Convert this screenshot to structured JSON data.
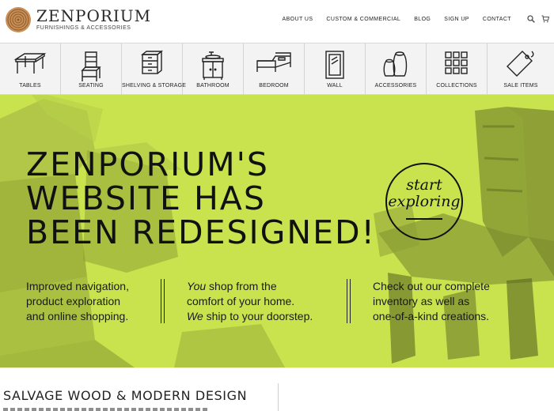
{
  "header": {
    "logo_name": "ZENPORIUM",
    "logo_tagline": "FURNISHINGS & ACCESSORIES",
    "nav": [
      "ABOUT US",
      "CUSTOM & COMMERCIAL",
      "BLOG",
      "SIGN UP",
      "CONTACT"
    ],
    "icons": [
      "search-icon",
      "cart-icon"
    ]
  },
  "categories": [
    {
      "label": "TABLES",
      "icon": "table-icon"
    },
    {
      "label": "SEATING",
      "icon": "chair-icon"
    },
    {
      "label": "SHELVING & STORAGE",
      "icon": "drawers-icon"
    },
    {
      "label": "BATHROOM",
      "icon": "vanity-icon"
    },
    {
      "label": "BEDROOM",
      "icon": "bed-icon"
    },
    {
      "label": "WALL",
      "icon": "mirror-icon"
    },
    {
      "label": "ACCESSORIES",
      "icon": "vases-icon"
    },
    {
      "label": "COLLECTIONS",
      "icon": "grid-icon"
    },
    {
      "label": "SALE ITEMS",
      "icon": "tag-icon"
    }
  ],
  "hero": {
    "headline": [
      "ZENPORIUM'S",
      "WEBSITE HAS",
      "BEEN REDESIGNED!"
    ],
    "badge": [
      "start",
      "exploring"
    ],
    "col1": [
      "Improved navigation,",
      "product exploration",
      "and online shopping."
    ],
    "col2": [
      {
        "em": "You",
        "text": " shop from the"
      },
      {
        "em": "",
        "text": "comfort of your home."
      },
      {
        "em": "We",
        "text": " ship to your doorstep."
      }
    ],
    "col3": [
      "Check out our complete",
      "inventory as well as",
      "one-of-a-kind creations."
    ],
    "colors": {
      "background": "#c9e34f",
      "text": "#111111"
    }
  },
  "section": {
    "title": "SALVAGE WOOD & MODERN DESIGN"
  }
}
